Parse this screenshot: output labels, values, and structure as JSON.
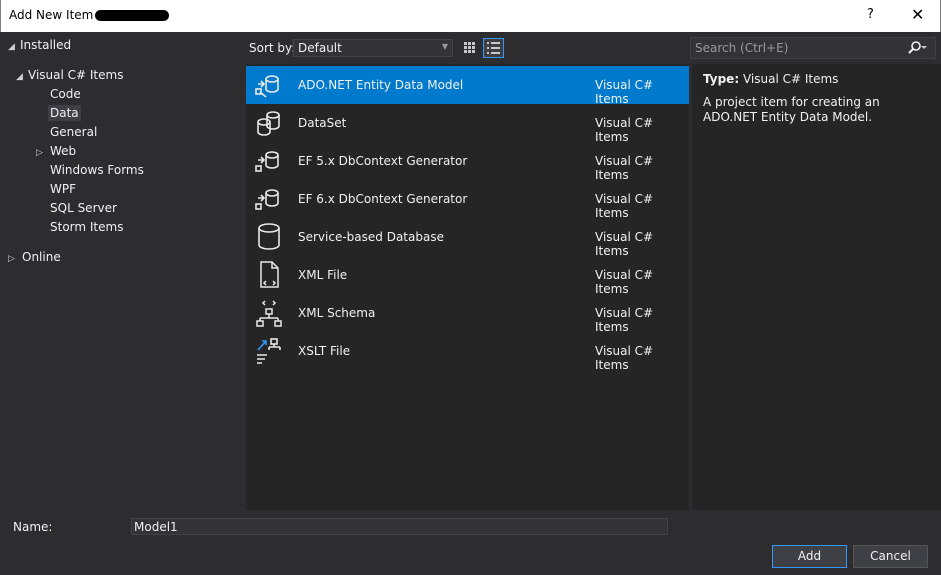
{
  "window": {
    "title": "Add New Item -",
    "help_glyph": "?",
    "close_glyph": "✕"
  },
  "tree": {
    "installed": "Installed",
    "visual_csharp": "Visual C# Items",
    "children": [
      "Code",
      "Data",
      "General",
      "Web",
      "Windows Forms",
      "WPF",
      "SQL Server",
      "Storm Items"
    ],
    "online": "Online",
    "selected": "Data"
  },
  "toolbar": {
    "sort_label": "Sort by:",
    "sort_value": "Default"
  },
  "search": {
    "placeholder": "Search (Ctrl+E)"
  },
  "items": [
    {
      "name": "ADO.NET Entity Data Model",
      "category": "Visual C# Items",
      "icon": "entity-model-icon"
    },
    {
      "name": "DataSet",
      "category": "Visual C# Items",
      "icon": "dataset-icon"
    },
    {
      "name": "EF 5.x DbContext Generator",
      "category": "Visual C# Items",
      "icon": "ef-generator-icon"
    },
    {
      "name": "EF 6.x DbContext Generator",
      "category": "Visual C# Items",
      "icon": "ef-generator-icon"
    },
    {
      "name": "Service-based Database",
      "category": "Visual C# Items",
      "icon": "database-icon"
    },
    {
      "name": "XML File",
      "category": "Visual C# Items",
      "icon": "xml-file-icon"
    },
    {
      "name": "XML Schema",
      "category": "Visual C# Items",
      "icon": "xml-schema-icon"
    },
    {
      "name": "XSLT File",
      "category": "Visual C# Items",
      "icon": "xslt-file-icon"
    }
  ],
  "details": {
    "type_label": "Type:",
    "type_value": "Visual C# Items",
    "description": "A project item for creating an ADO.NET Entity Data Model."
  },
  "name_field": {
    "label": "Name:",
    "value": "Model1"
  },
  "buttons": {
    "add": "Add",
    "cancel": "Cancel"
  },
  "colors": {
    "accent": "#007acc",
    "background": "#2d2d30",
    "panel": "#252526"
  }
}
